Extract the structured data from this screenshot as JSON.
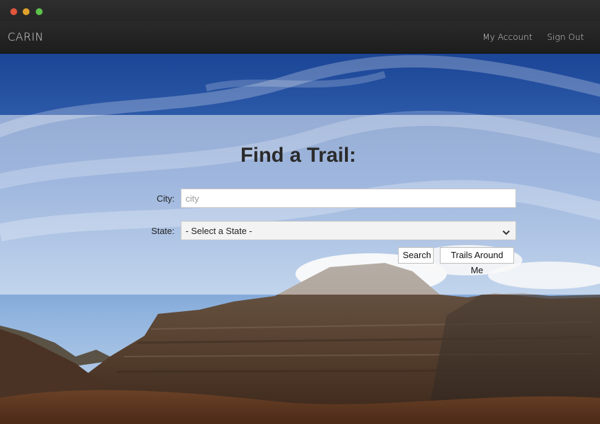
{
  "window": {
    "controls": [
      "close",
      "minimize",
      "maximize"
    ]
  },
  "navbar": {
    "brand": "CARIN",
    "links": {
      "account": "My Account",
      "signout": "Sign Out"
    }
  },
  "search": {
    "title": "Find a Trail:",
    "city_label": "City:",
    "city_placeholder": "city",
    "city_value": "",
    "state_label": "State:",
    "state_selected": "- Select a State -",
    "search_button": "Search",
    "around_button": "Trails Around Me"
  },
  "colors": {
    "navbar": "#222222",
    "sky": "#1e4a9a",
    "panel_overlay": "rgba(255,255,255,0.5)"
  }
}
